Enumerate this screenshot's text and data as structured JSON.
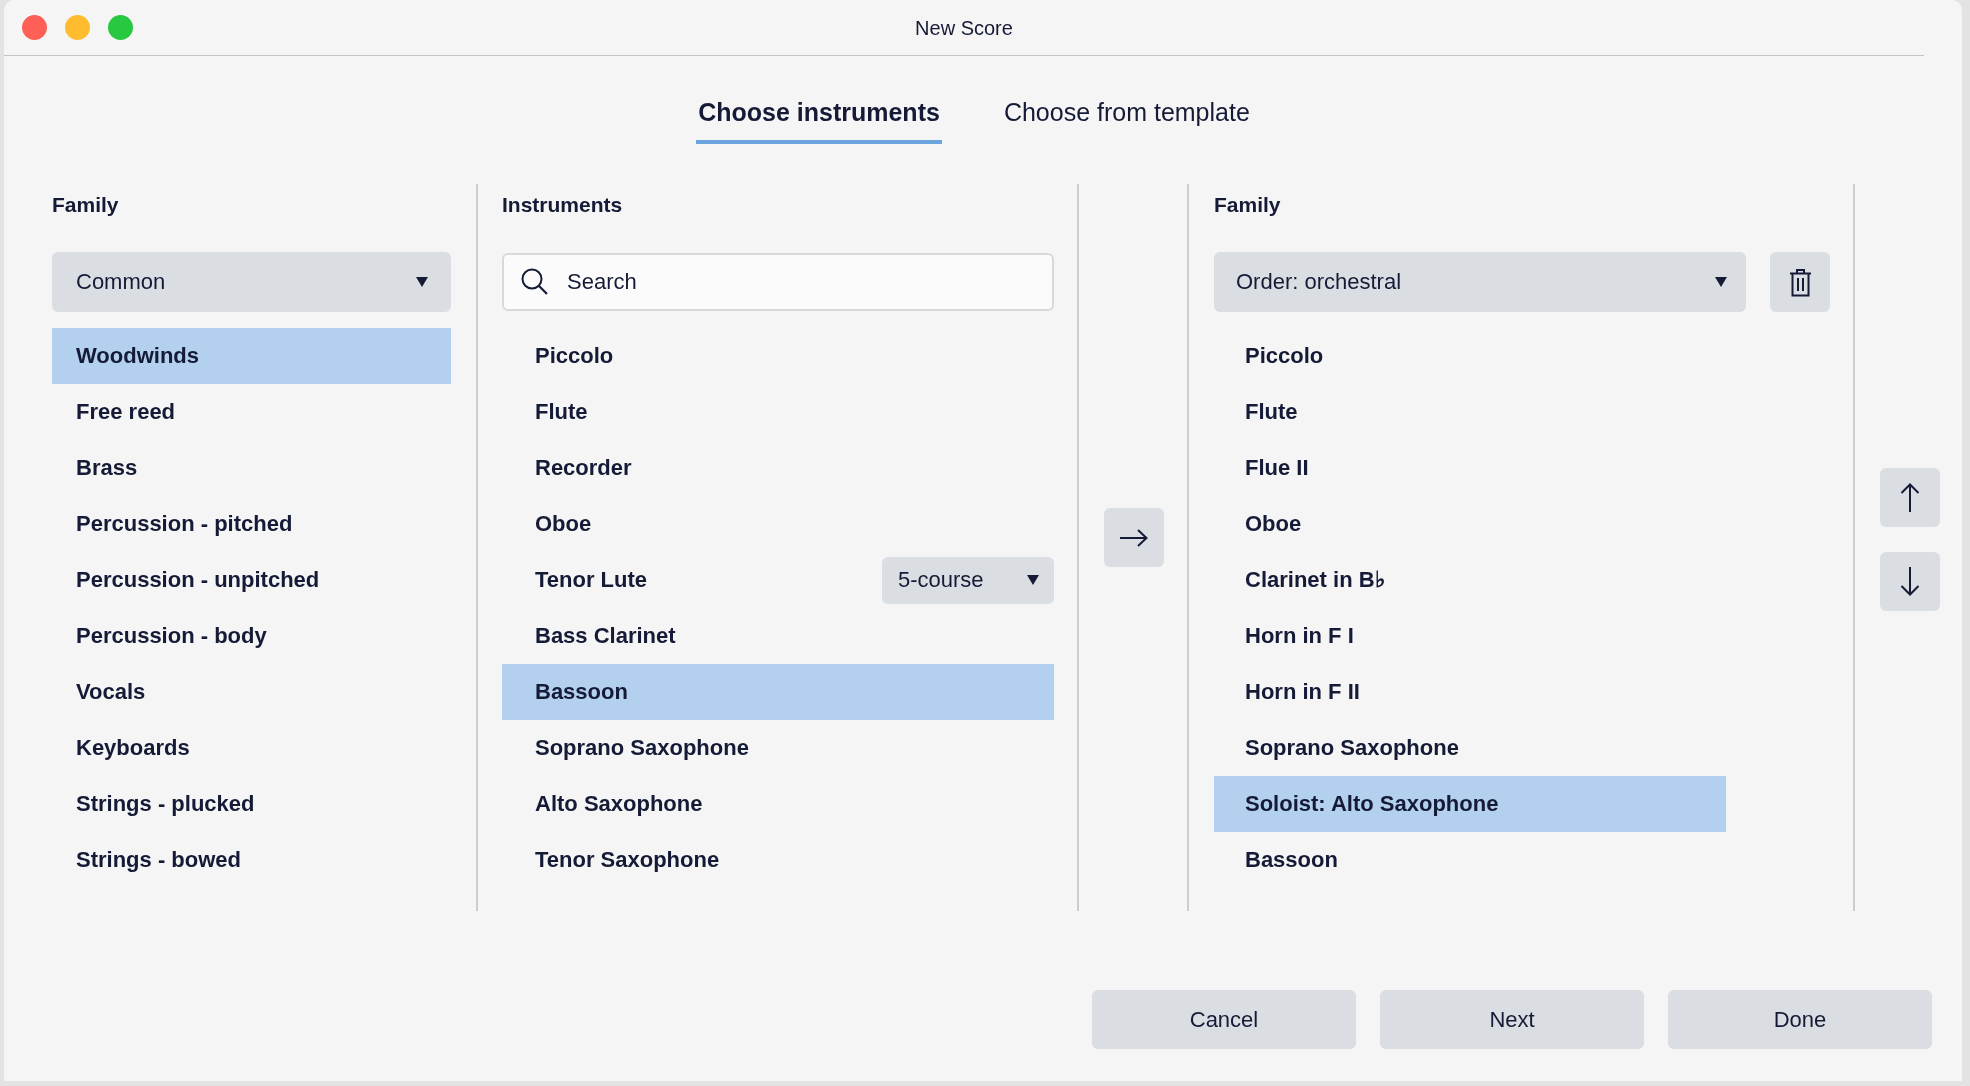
{
  "window": {
    "title": "New Score"
  },
  "tabs": [
    {
      "label": "Choose instruments",
      "selected": true
    },
    {
      "label": "Choose from template",
      "selected": false
    }
  ],
  "family_panel": {
    "heading": "Family",
    "dropdown": {
      "value": "Common"
    },
    "items": [
      {
        "label": "Woodwinds",
        "selected": true
      },
      {
        "label": "Free reed",
        "selected": false
      },
      {
        "label": "Brass",
        "selected": false
      },
      {
        "label": "Percussion - pitched",
        "selected": false
      },
      {
        "label": "Percussion - unpitched",
        "selected": false
      },
      {
        "label": "Percussion - body",
        "selected": false
      },
      {
        "label": "Vocals",
        "selected": false
      },
      {
        "label": "Keyboards",
        "selected": false
      },
      {
        "label": "Strings - plucked",
        "selected": false
      },
      {
        "label": "Strings - bowed",
        "selected": false
      }
    ]
  },
  "instruments_panel": {
    "heading": "Instruments",
    "search": {
      "placeholder": "Search"
    },
    "items": [
      {
        "label": "Piccolo",
        "selected": false
      },
      {
        "label": "Flute",
        "selected": false
      },
      {
        "label": "Recorder",
        "selected": false
      },
      {
        "label": "Oboe",
        "selected": false
      },
      {
        "label": "Tenor Lute",
        "selected": false,
        "option": "5-course"
      },
      {
        "label": "Bass Clarinet",
        "selected": false
      },
      {
        "label": "Bassoon",
        "selected": true
      },
      {
        "label": "Soprano Saxophone",
        "selected": false
      },
      {
        "label": "Alto Saxophone",
        "selected": false
      },
      {
        "label": "Tenor Saxophone",
        "selected": false
      }
    ]
  },
  "score_panel": {
    "heading": "Family",
    "order_dropdown": {
      "value": "Order: orchestral"
    },
    "items": [
      {
        "label": "Piccolo",
        "selected": false
      },
      {
        "label": "Flute",
        "selected": false
      },
      {
        "label": "Flue II",
        "selected": false
      },
      {
        "label": "Oboe",
        "selected": false
      },
      {
        "label": "Clarinet in B♭",
        "selected": false
      },
      {
        "label": "Horn in F I",
        "selected": false
      },
      {
        "label": "Horn in F II",
        "selected": false
      },
      {
        "label": "Soprano Saxophone",
        "selected": false
      },
      {
        "label": "Soloist: Alto Saxophone",
        "selected": true
      },
      {
        "label": "Bassoon",
        "selected": false
      }
    ]
  },
  "buttons": [
    "Cancel",
    "Next",
    "Done"
  ]
}
